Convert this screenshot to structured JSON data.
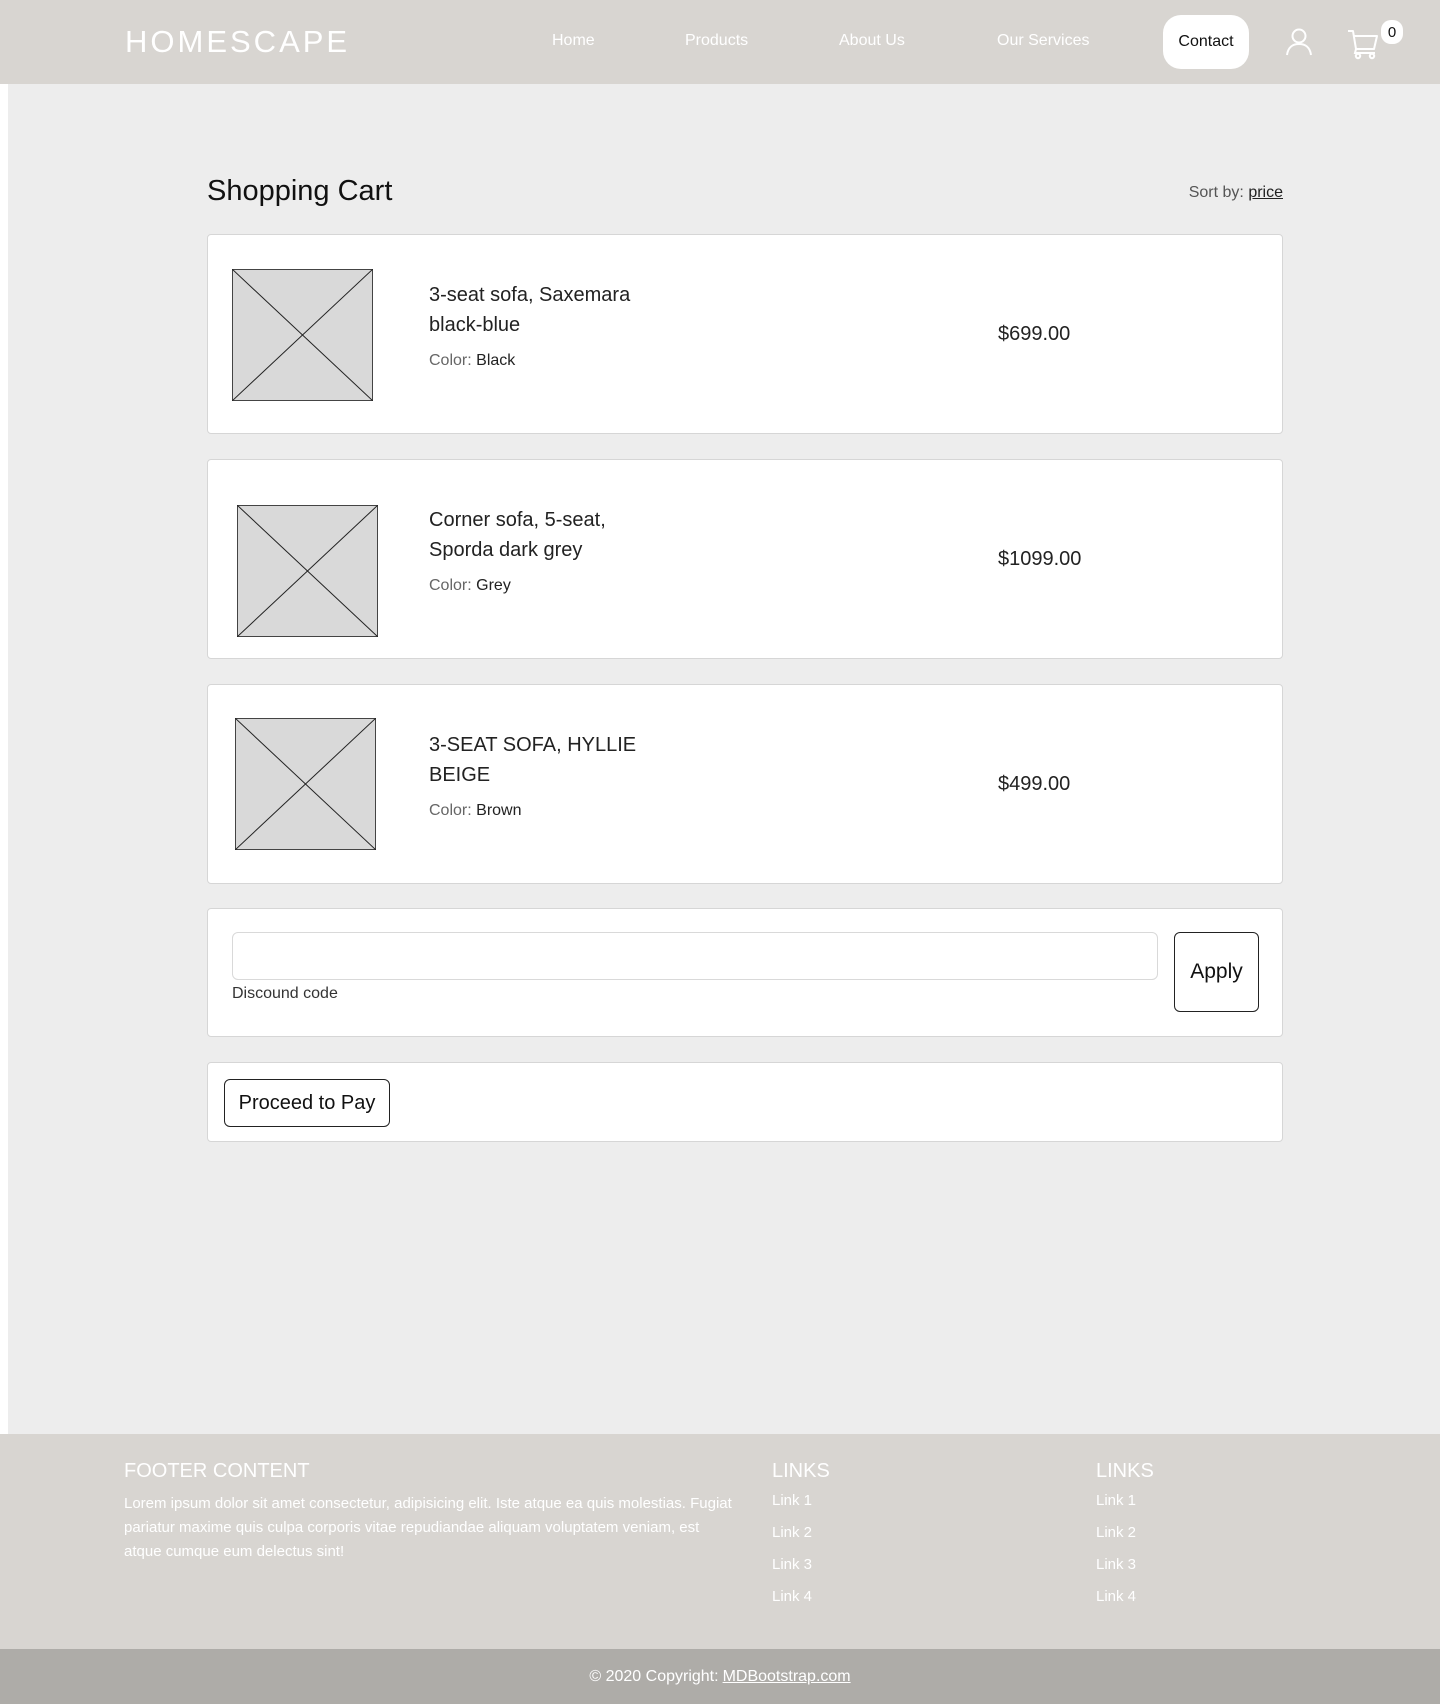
{
  "nav": {
    "brand": "HOMESCAPE",
    "links": [
      "Home",
      "Products",
      "About Us",
      "Our Services"
    ],
    "contact": "Contact",
    "cart_count": "0",
    "icons": {
      "user": "user-icon",
      "cart": "cart-icon"
    }
  },
  "cart": {
    "title": "Shopping Cart",
    "sort_label": "Sort by:",
    "sort_value": "price",
    "items": [
      {
        "name": "3-seat sofa, Saxemara black-blue",
        "color_label": "Color:",
        "color": "Black",
        "price": "$699.00"
      },
      {
        "name": "Corner sofa, 5-seat, Sporda dark grey",
        "color_label": "Color:",
        "color": "Grey",
        "price": "$1099.00"
      },
      {
        "name": "3-SEAT SOFA, HYLLIE BEIGE",
        "color_label": "Color:",
        "color": "Brown",
        "price": "$499.00"
      }
    ],
    "discount": {
      "value": "",
      "placeholder": "",
      "label": "Discound code",
      "apply": "Apply"
    },
    "proceed": "Proceed to Pay"
  },
  "footer": {
    "content_heading": "FOOTER CONTENT",
    "content_text": "Lorem ipsum dolor sit amet consectetur, adipisicing elit. Iste atque ea quis molestias. Fugiat pariatur maxime quis culpa corporis vitae repudiandae aliquam voluptatem veniam, est atque cumque eum delectus sint!",
    "links_heading_1": "LINKS",
    "links_1": [
      "Link 1",
      "Link 2",
      "Link 3",
      "Link 4"
    ],
    "links_heading_2": "LINKS",
    "links_2": [
      "Link 1",
      "Link 2",
      "Link 3",
      "Link 4"
    ],
    "copyright_text": "© 2020 Copyright:",
    "copyright_link": "MDBootstrap.com"
  },
  "colors": {
    "nav_bg": "#d8d5d1",
    "page_bg": "#ededed",
    "copyright_bg": "#aeaca8"
  }
}
